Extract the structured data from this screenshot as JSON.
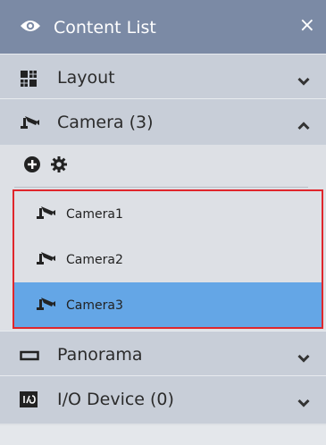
{
  "window": {
    "title": "Content List",
    "close_label": "×"
  },
  "sections": {
    "layout": {
      "label": "Layout",
      "expanded": false
    },
    "camera": {
      "label": "Camera (3)",
      "expanded": true
    },
    "panorama": {
      "label": "Panorama",
      "expanded": false
    },
    "io_device": {
      "label": "I/O Device (0)",
      "expanded": false
    }
  },
  "toolbar": {
    "add_icon": "plus-circle-icon",
    "settings_icon": "gear-icon"
  },
  "cameras": [
    {
      "name": "Camera1",
      "selected": false
    },
    {
      "name": "Camera2",
      "selected": false
    },
    {
      "name": "Camera3",
      "selected": true
    }
  ],
  "colors": {
    "titlebar": "#7b8aa5",
    "section_header": "#c8ced8",
    "selection": "#64a6e6",
    "highlight_border": "#e0262c"
  }
}
